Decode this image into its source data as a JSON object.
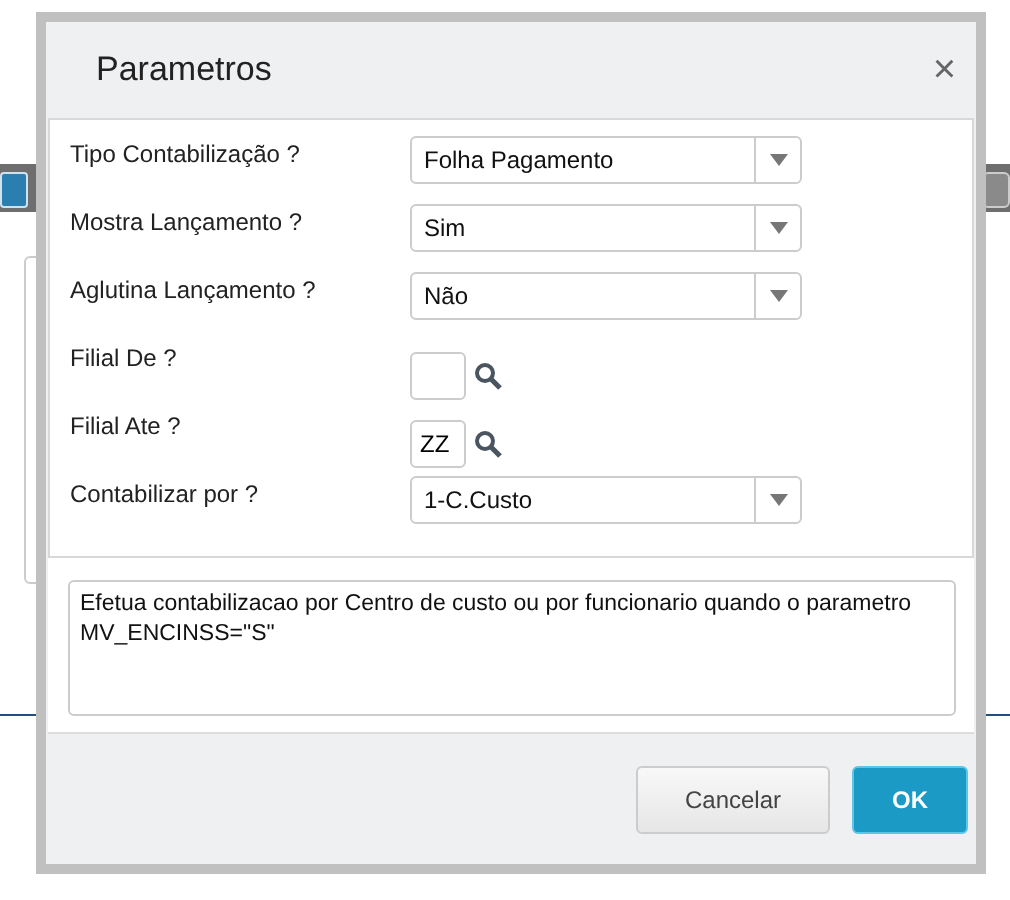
{
  "dialog": {
    "title": "Parametros",
    "close": "×"
  },
  "fields": [
    {
      "kind": "select",
      "label": "Tipo Contabilização ?",
      "value": "Folha Pagamento"
    },
    {
      "kind": "select",
      "label": "Mostra Lançamento ?",
      "value": "Sim"
    },
    {
      "kind": "select",
      "label": "Aglutina Lançamento ?",
      "value": "Não"
    },
    {
      "kind": "lookup",
      "label": "Filial De ?"
    },
    {
      "kind": "lookup",
      "label": "Filial Ate ?",
      "value": "ZZ"
    },
    {
      "kind": "select",
      "label": "Contabilizar por ?",
      "value": "1-C.Custo"
    }
  ],
  "description": "Efetua contabilizacao por Centro de custo ou por funcionario quando o parametro MV_ENCINSS=\"S\"",
  "buttons": [
    {
      "kind": "secondary",
      "label": "Cancelar"
    },
    {
      "kind": "primary",
      "label": "OK"
    }
  ]
}
